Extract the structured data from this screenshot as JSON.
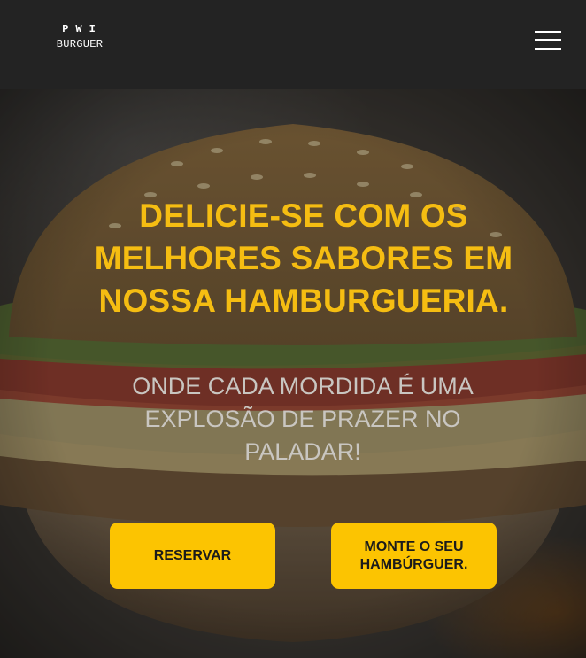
{
  "header": {
    "logo_top": "PWI",
    "logo_bottom": "BURGUER"
  },
  "hero": {
    "headline": "DELICIE-SE COM OS MELHORES SABORES EM NOSSA HAMBURGUERIA.",
    "subline": "ONDE CADA MORDIDA É UMA EXPLOSÃO DE PRAZER NO PALADAR!",
    "reserve_label": "RESERVAR",
    "build_label": "MONTE O SEU HAMBÚRGUER."
  },
  "colors": {
    "accent": "#fcc401",
    "headline": "#f5bd12",
    "header_bg": "#232323"
  },
  "icons": {
    "menu": "hamburger-menu-icon"
  }
}
